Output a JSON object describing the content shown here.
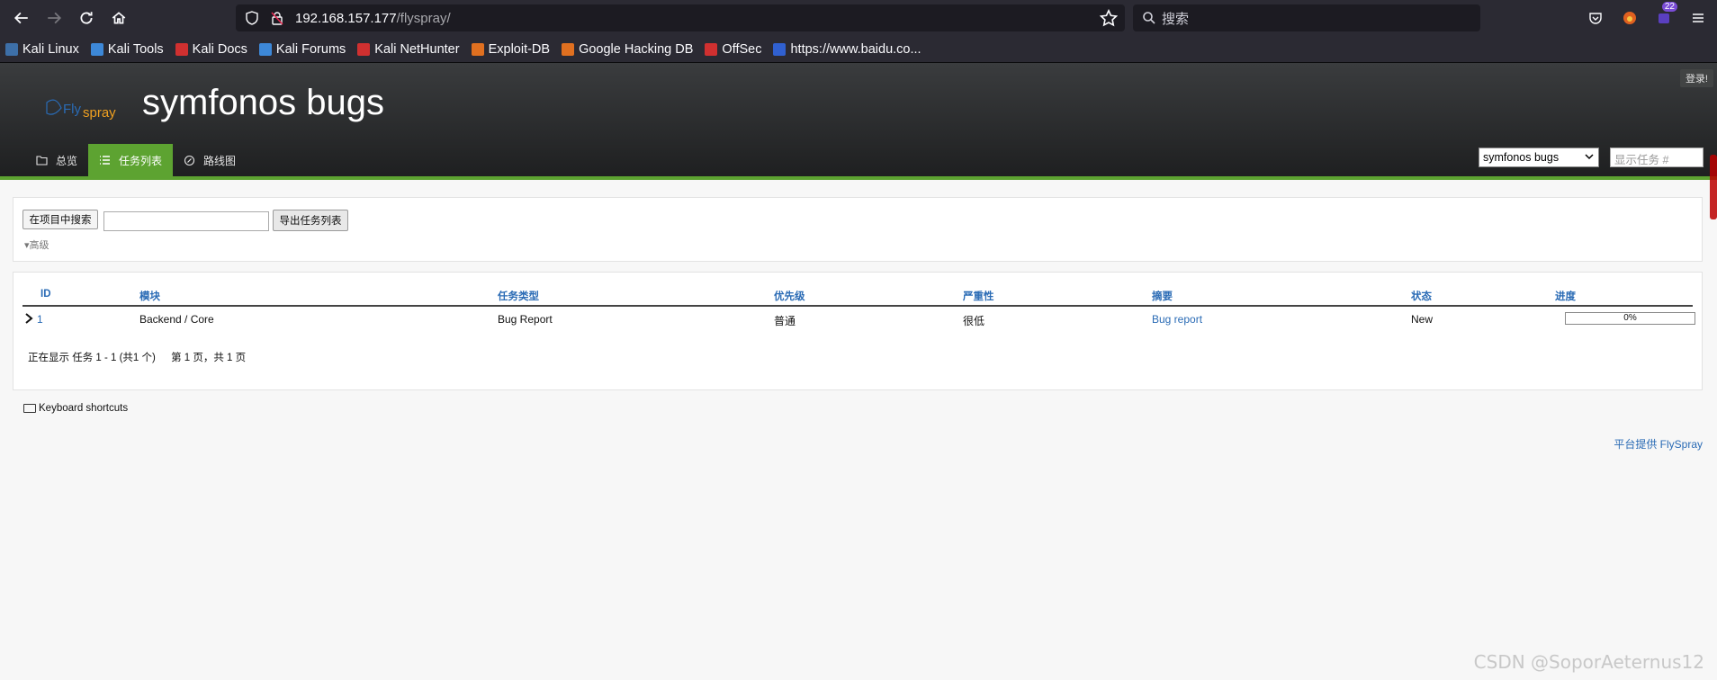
{
  "browser": {
    "url_host": "192.168.157.177",
    "url_path": "/flyspray/",
    "search_placeholder": "搜索",
    "badge_count": "22"
  },
  "bookmarks": [
    {
      "label": "Kali Linux",
      "color": "#3d6fa8"
    },
    {
      "label": "Kali Tools",
      "color": "#3d88d8"
    },
    {
      "label": "Kali Docs",
      "color": "#d03030"
    },
    {
      "label": "Kali Forums",
      "color": "#3d88d8"
    },
    {
      "label": "Kali NetHunter",
      "color": "#d03030"
    },
    {
      "label": "Exploit-DB",
      "color": "#e07020"
    },
    {
      "label": "Google Hacking DB",
      "color": "#e07020"
    },
    {
      "label": "OffSec",
      "color": "#d03030"
    },
    {
      "label": "https://www.baidu.co...",
      "color": "#3060d0"
    }
  ],
  "header": {
    "logo_text_fly": "Fly",
    "logo_text_spray": "spray",
    "title": "symfonos bugs",
    "login": "登录!"
  },
  "tabs": [
    {
      "label": "总览",
      "icon": "folder-icon",
      "active": false
    },
    {
      "label": "任务列表",
      "icon": "list-icon",
      "active": true
    },
    {
      "label": "路线图",
      "icon": "roadmap-icon",
      "active": false
    }
  ],
  "project_select": "symfonos bugs",
  "task_jump_placeholder": "显示任务 #",
  "search": {
    "button": "在项目中搜索",
    "export": "导出任务列表",
    "advanced": "▾高级"
  },
  "table": {
    "headers": [
      "ID",
      "模块",
      "任务类型",
      "优先级",
      "严重性",
      "摘要",
      "状态",
      "进度"
    ],
    "rows": [
      {
        "id": "1",
        "category": "Backend / Core",
        "type": "Bug Report",
        "priority": "普通",
        "severity": "很低",
        "summary": "Bug report",
        "status": "New",
        "progress": "0%",
        "progress_value": 0
      }
    ]
  },
  "pager": {
    "showing": "正在显示 任务 1 - 1 (共1 个)",
    "page": "第 1 页，共 1 页"
  },
  "footer": {
    "shortcuts": "Keyboard shortcuts",
    "powered": "平台提供 FlySpray"
  },
  "watermark": "CSDN @SoporAeternus12"
}
